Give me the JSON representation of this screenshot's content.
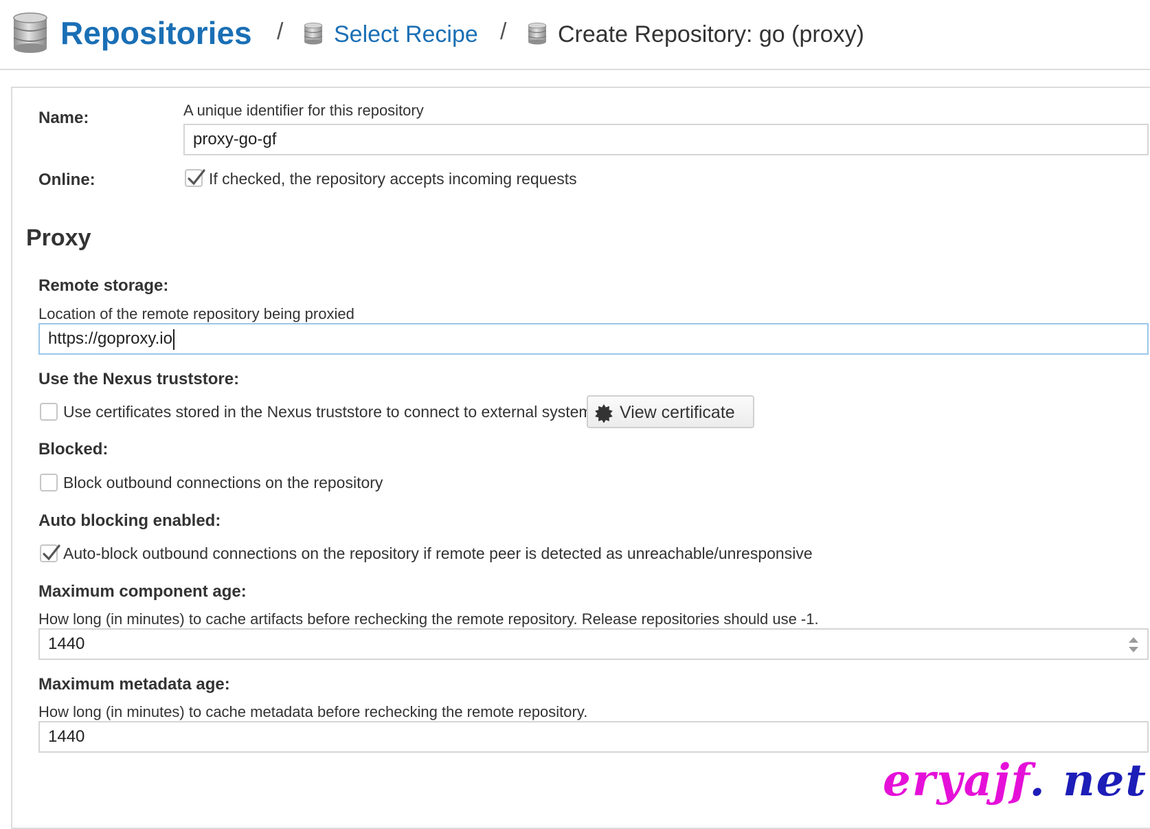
{
  "breadcrumb": {
    "root": {
      "label": "Repositories",
      "icon": "database-icon"
    },
    "separator": "/",
    "middle": {
      "label": "Select Recipe",
      "icon": "database-icon"
    },
    "current": {
      "label": "Create Repository: go (proxy)",
      "icon": "database-icon"
    }
  },
  "form": {
    "name": {
      "label": "Name:",
      "help": "A unique identifier for this repository",
      "value": "proxy-go-gf"
    },
    "online": {
      "label": "Online:",
      "checked": true,
      "text": "If checked, the repository accepts incoming requests"
    },
    "proxy_section": {
      "title": "Proxy",
      "remote_storage": {
        "label": "Remote storage:",
        "help": "Location of the remote repository being proxied",
        "value": "https://goproxy.io"
      },
      "truststore": {
        "label": "Use the Nexus truststore:",
        "checked": false,
        "text": "Use certificates stored in the Nexus truststore to connect to external systems",
        "button_label": "View certificate",
        "button_icon": "certificate-icon"
      },
      "blocked": {
        "label": "Blocked:",
        "checked": false,
        "text": "Block outbound connections on the repository"
      },
      "auto_blocking": {
        "label": "Auto blocking enabled:",
        "checked": true,
        "text": "Auto-block outbound connections on the repository if remote peer is detected as unreachable/unresponsive"
      },
      "max_component_age": {
        "label": "Maximum component age:",
        "help": "How long (in minutes) to cache artifacts before rechecking the remote repository. Release repositories should use -1.",
        "value": "1440"
      },
      "max_metadata_age": {
        "label": "Maximum metadata age:",
        "help": "How long (in minutes) to cache metadata before rechecking the remote repository.",
        "value": "1440"
      }
    }
  },
  "watermark": {
    "part1": "eryajf",
    "part2": ". net"
  },
  "colors": {
    "link": "#1a6fb5",
    "text": "#333333",
    "border": "#d5d5d5",
    "focus_border": "#9bc7ea",
    "watermark_pink": "#e510d8",
    "watermark_blue": "#1d1db8"
  }
}
